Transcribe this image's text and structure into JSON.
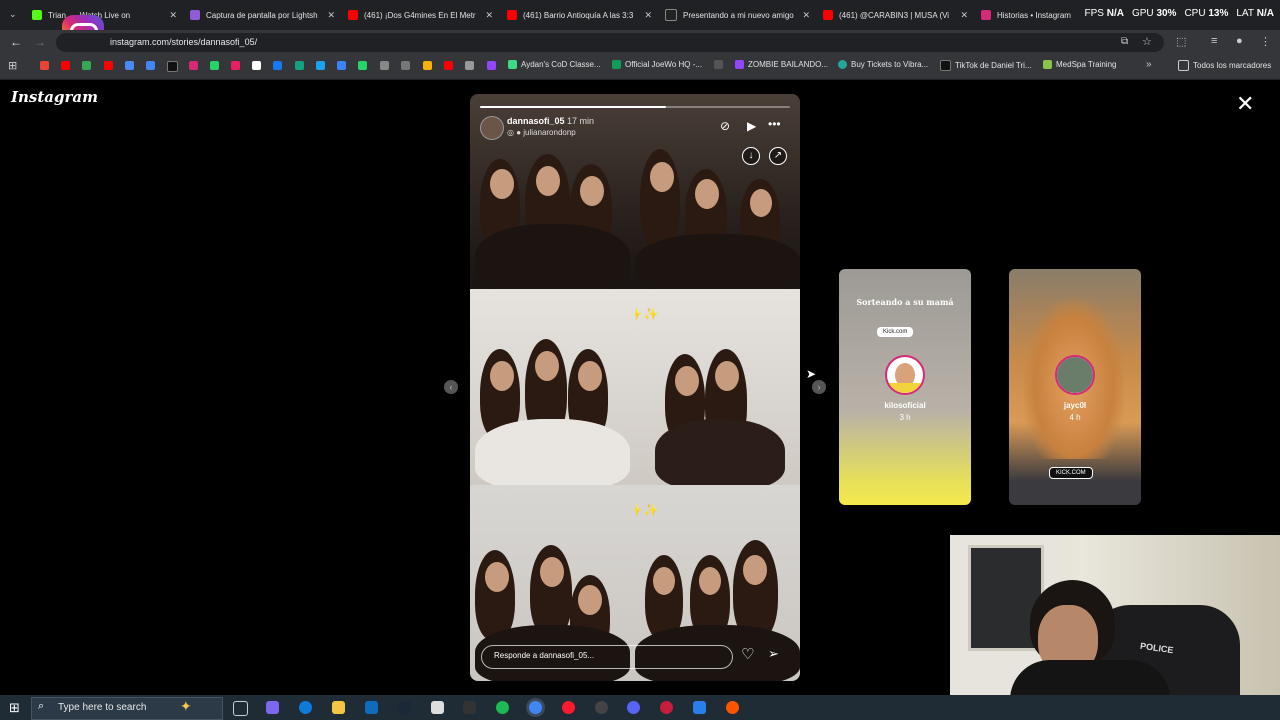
{
  "browser": {
    "tabs": [
      {
        "label": "Trian... - Watch Live on",
        "color": "#53fc18"
      },
      {
        "label": "Captura de pantalla por Lightsh",
        "color": "#8f5bd6"
      },
      {
        "label": "(461) ¡Dos G4mines En El Metr",
        "color": "#ff0000"
      },
      {
        "label": "(461) Barrio Antioquía A las 3:3",
        "color": "#ff0000"
      },
      {
        "label": "Presentando a mi nuevo amigo",
        "color": "#222222"
      },
      {
        "label": "(461) @CARABIN3 | MUSA (Vi",
        "color": "#ff0000"
      },
      {
        "label": "Historias • Instagram",
        "color": "#d62976"
      }
    ],
    "url": "instagram.com/stories/dannasofi_05/",
    "bookmarks": [
      "Aydan's CoD Classe...",
      "Official JoeWo HQ -...",
      "ZOMBIE BAILANDO...",
      "Buy Tickets to Vibra...",
      "TikTok de Daniel Tri...",
      "MedSpa Training"
    ],
    "all_bookmarks_label": "Todos los marcadores"
  },
  "hud": [
    {
      "label": "FPS",
      "value": "N/A"
    },
    {
      "label": "GPU",
      "value": "30%"
    },
    {
      "label": "CPU",
      "value": "13%"
    },
    {
      "label": "LAT",
      "value": "N/A"
    }
  ],
  "instagram": {
    "logo": "Instagram",
    "story": {
      "username": "dannasofi_05",
      "time": "17 min",
      "collaborator": "julianarondonp",
      "reply_placeholder": "Responde a dannasofi_05...",
      "progress": 0.6
    },
    "next_stories": [
      {
        "name": "kilosoficial",
        "time": "3 h",
        "caption": "Sorteando a su mamá",
        "link": "Kick.com"
      },
      {
        "name": "jayc0l",
        "time": "4 h",
        "link": "KICK.COM"
      }
    ]
  },
  "taskbar": {
    "search_placeholder": "Type here to search"
  }
}
